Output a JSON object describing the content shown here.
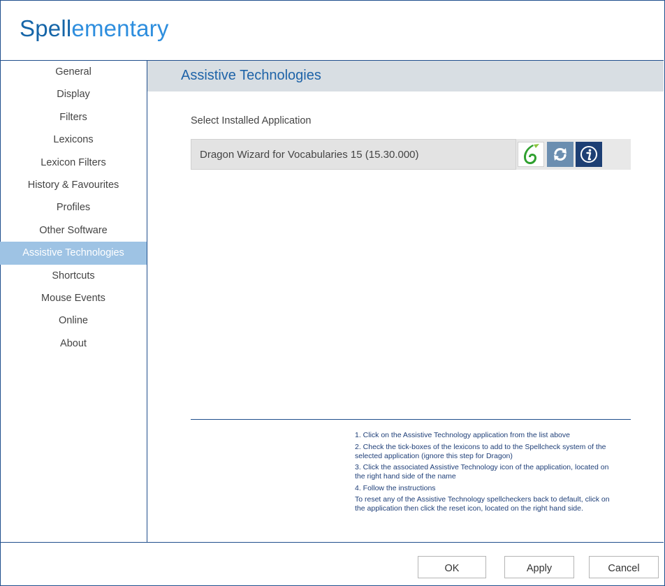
{
  "app": {
    "title_part1": "Spell",
    "title_part2": "ementary",
    "colors": {
      "primary": "#1565a8",
      "accent": "#2e8ede",
      "border": "#1f4e8c",
      "active_nav_bg": "#9ec3e4",
      "header_bg": "#d8dee3"
    }
  },
  "sidebar": {
    "items": [
      {
        "label": "General"
      },
      {
        "label": "Display"
      },
      {
        "label": "Filters"
      },
      {
        "label": "Lexicons"
      },
      {
        "label": "Lexicon Filters"
      },
      {
        "label": "History & Favourites"
      },
      {
        "label": "Profiles"
      },
      {
        "label": "Other Software"
      },
      {
        "label": "Assistive Technologies"
      },
      {
        "label": "Shortcuts"
      },
      {
        "label": "Mouse Events"
      },
      {
        "label": "Online"
      },
      {
        "label": "About"
      }
    ],
    "active_label": "Assistive Technologies"
  },
  "main": {
    "section_title": "Assistive Technologies",
    "select_label": "Select Installed Application",
    "application": {
      "name": "Dragon Wizard for Vocabularies 15 (15.30.000)",
      "icons": [
        "dragon-icon",
        "reset-icon",
        "info-icon"
      ]
    },
    "instructions": [
      "1. Click on the Assistive Technology application from the list above",
      "2. Check the tick-boxes of the lexicons to add to the Spellcheck system of the selected application (ignore this step for Dragon)",
      "3. Click the associated Assistive Technology icon of the application, located on the right hand side of the name",
      "4. Follow the instructions",
      "To reset any of the Assistive Technology spellcheckers back to default, click on the application then click the reset icon, located on the right hand side."
    ]
  },
  "footer": {
    "ok_label": "OK",
    "apply_label": "Apply",
    "cancel_label": "Cancel"
  }
}
